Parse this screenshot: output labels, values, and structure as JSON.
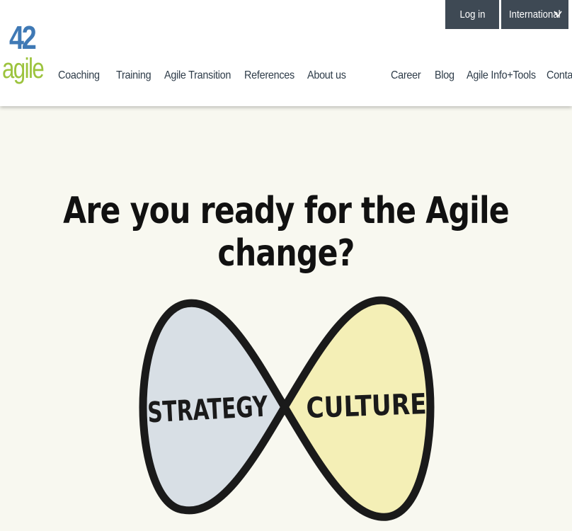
{
  "header": {
    "logo": {
      "number": "42",
      "word": "agile",
      "colors": {
        "number": "#3f79b5",
        "word": "#9cc33d"
      }
    },
    "top_buttons": {
      "login_label": "Log in",
      "international_label": "International",
      "international_icon": "chevron-down-icon"
    },
    "nav_left": [
      "Coaching",
      "Training",
      "Agile Transition",
      "References",
      "About us"
    ],
    "nav_right": [
      "Career",
      "Blog",
      "Agile Info+Tools",
      "Contact"
    ]
  },
  "hero": {
    "headline": "Are you ready for the Agile change?",
    "illustration": {
      "left_label": "STRATEGY",
      "right_label": "CULTURE",
      "colors": {
        "left_fill": "#d8dfe5",
        "right_fill": "#f4efb6",
        "outline": "#1a1a1a"
      }
    }
  },
  "colors": {
    "page_background": "#f8f8f0",
    "header_background": "#ffffff",
    "button_background": "#3e4954",
    "nav_text": "#2d3b48"
  }
}
